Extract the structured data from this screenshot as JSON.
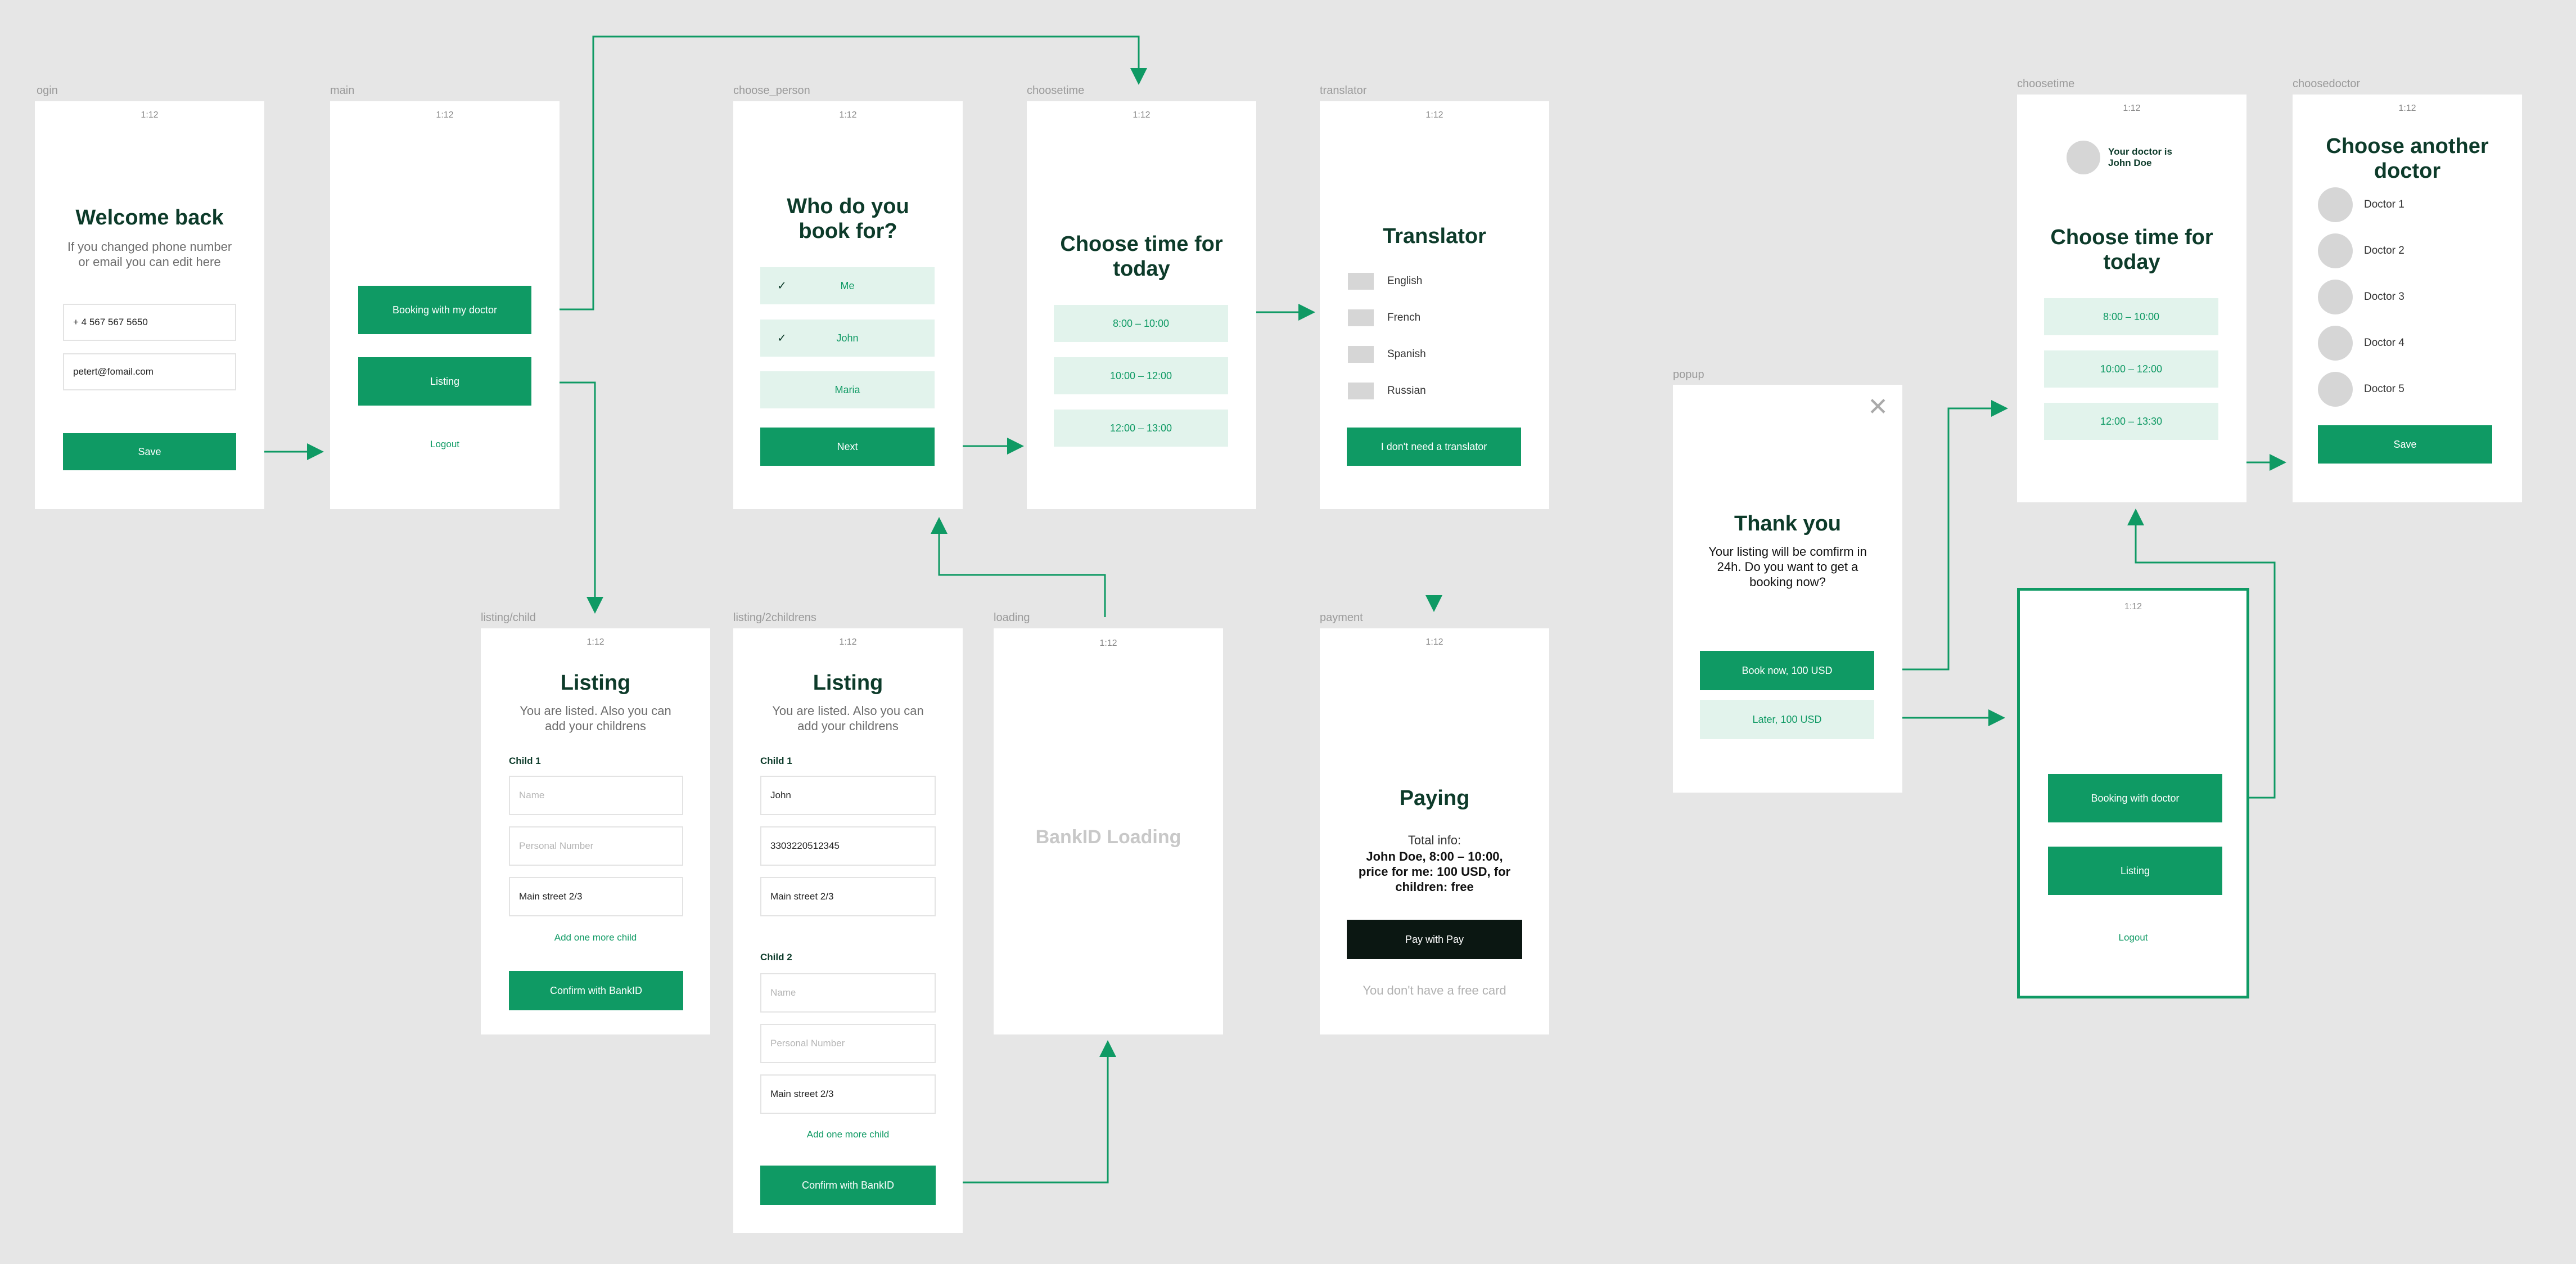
{
  "status_bar": {
    "time": "1:12"
  },
  "frames": {
    "login": {
      "label": "ogin",
      "title": "Welcome back",
      "subtitle": "If you changed phone number or email you can edit here",
      "phone_value": "+ 4 567 567 5650",
      "email_value": "petert@fomail.com",
      "save_label": "Save"
    },
    "main": {
      "label": "main",
      "booking_label": "Booking with my doctor",
      "listing_label": "Listing",
      "logout_label": "Logout"
    },
    "choose_person": {
      "label": "choose_person",
      "title": "Who do you book for?",
      "options": [
        "Me",
        "John",
        "Maria"
      ],
      "next_label": "Next"
    },
    "choose_time": {
      "label": "choosetime",
      "title": "Choose time for today",
      "slots": [
        "8:00 – 10:00",
        "10:00 – 12:00",
        "12:00 – 13:00"
      ]
    },
    "translator": {
      "label": "translator",
      "title": "Translator",
      "languages": [
        "English",
        "French",
        "Spanish",
        "Russian"
      ],
      "skip_label": "I don't need a translator"
    },
    "listing_child": {
      "label": "listing/child",
      "title": "Listing",
      "subtitle": "You are listed. Also you can add your childrens",
      "child_label": "Child 1",
      "name_placeholder": "Name",
      "personal_placeholder": "Personal Number",
      "address_value": "Main street 2/3",
      "add_label": "Add one more child",
      "confirm_label": "Confirm with BankID"
    },
    "listing_2children": {
      "label": "listing/2childrens",
      "title": "Listing",
      "subtitle": "You are listed. Also you can add your childrens",
      "child1_label": "Child 1",
      "child1_name": "John",
      "child1_personal": "3303220512345",
      "child1_address": "Main street 2/3",
      "child2_label": "Child 2",
      "name_placeholder": "Name",
      "personal_placeholder": "Personal Number",
      "child2_address": "Main street 2/3",
      "add_label": "Add one more child",
      "confirm_label": "Confirm with BankID"
    },
    "loading": {
      "label": "loading",
      "text": "BankID Loading"
    },
    "payment": {
      "label": "payment",
      "title": "Paying",
      "total_label": "Total info:",
      "detail": "John Doe, 8:00 – 10:00, price for me: 100 USD, for children: free",
      "pay_label": "Pay with  Pay",
      "free_card_text": "You don't have a free card"
    },
    "popup": {
      "label": "popup",
      "title": "Thank you",
      "body": "Your listing will be comfirm in 24h. Do you want to get a booking now?",
      "book_now_label": "Book now, 100 USD",
      "later_label": "Later, 100 USD"
    },
    "choose_time_2": {
      "label": "choosetime",
      "doctor_text": "Your doctor is John Doe",
      "title": "Choose time for today",
      "slots": [
        "8:00 – 10:00",
        "10:00 – 12:00",
        "12:00 – 13:30"
      ]
    },
    "choose_doctor": {
      "label": "choosedoctor",
      "title": "Choose another doctor",
      "doctors": [
        "Doctor 1",
        "Doctor 2",
        "Doctor 3",
        "Doctor 4",
        "Doctor 5"
      ],
      "save_label": "Save"
    },
    "main_2": {
      "booking_label": "Booking with doctor",
      "listing_label": "Listing",
      "logout_label": "Logout"
    }
  },
  "colors": {
    "accent": "#0f9a64",
    "accent_light": "#e2f3ec",
    "canvas": "#e6e6e6",
    "dark": "#0b1712"
  },
  "icons": [
    "check-icon",
    "close-icon",
    "apple-icon"
  ]
}
